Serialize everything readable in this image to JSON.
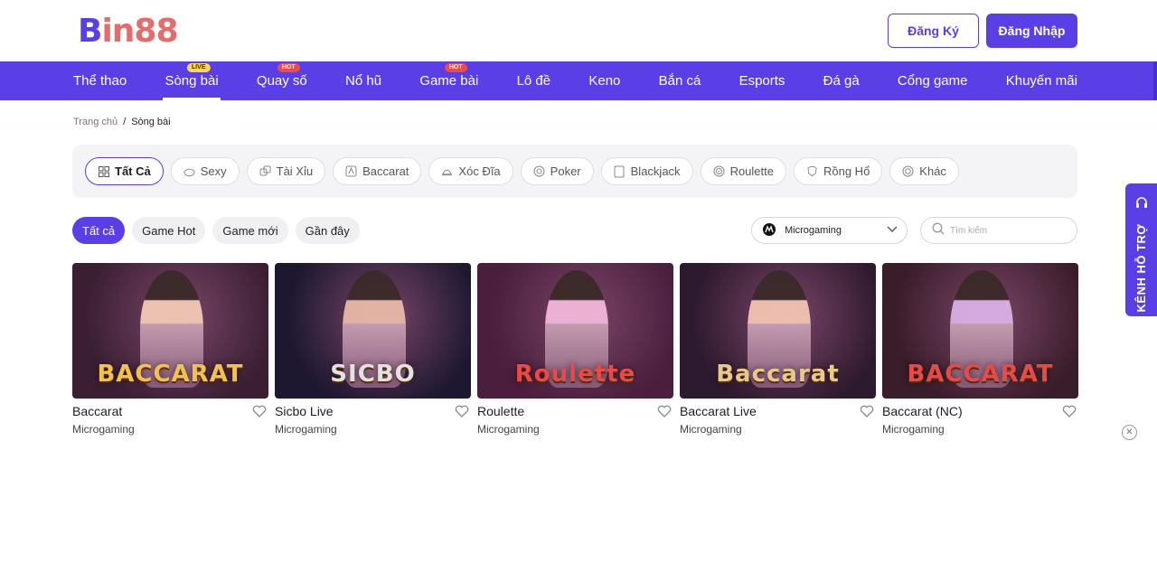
{
  "brand": {
    "logo_b": "B",
    "logo_rest": "in88"
  },
  "auth": {
    "register": "Đăng Ký",
    "login": "Đăng Nhập"
  },
  "nav": {
    "items": [
      {
        "label": "Thể thao",
        "badge": ""
      },
      {
        "label": "Sòng bài",
        "badge": "LIVE",
        "active": true
      },
      {
        "label": "Quay số",
        "badge": "HOT"
      },
      {
        "label": "Nổ hũ",
        "badge": ""
      },
      {
        "label": "Game bài",
        "badge": "HOT"
      },
      {
        "label": "Lô đề",
        "badge": ""
      },
      {
        "label": "Keno",
        "badge": ""
      },
      {
        "label": "Bắn cá",
        "badge": ""
      },
      {
        "label": "Esports",
        "badge": ""
      },
      {
        "label": "Đá gà",
        "badge": ""
      },
      {
        "label": "Cổng game",
        "badge": ""
      },
      {
        "label": "Khuyến mãi",
        "badge": ""
      }
    ]
  },
  "breadcrumb": {
    "home": "Trang chủ",
    "sep": "/",
    "current": "Sòng bài"
  },
  "categories": [
    {
      "label": "Tất Cả",
      "icon": "grid-icon",
      "active": true
    },
    {
      "label": "Sexy",
      "icon": "sexy-icon"
    },
    {
      "label": "Tài Xỉu",
      "icon": "dice-icon"
    },
    {
      "label": "Baccarat",
      "icon": "baccarat-icon"
    },
    {
      "label": "Xóc Đĩa",
      "icon": "xoc-dia-icon"
    },
    {
      "label": "Poker",
      "icon": "poker-chip-icon"
    },
    {
      "label": "Blackjack",
      "icon": "card-icon"
    },
    {
      "label": "Roulette",
      "icon": "roulette-icon"
    },
    {
      "label": "Rồng Hổ",
      "icon": "dragon-tiger-icon"
    },
    {
      "label": "Khác",
      "icon": "other-icon"
    }
  ],
  "filters": [
    {
      "label": "Tất cả",
      "active": true
    },
    {
      "label": "Game Hot"
    },
    {
      "label": "Game mới"
    },
    {
      "label": "Gần đây"
    }
  ],
  "provider_select": {
    "value": "Microgaming"
  },
  "search": {
    "placeholder": "Tìm kiếm"
  },
  "games": [
    {
      "name": "Baccarat",
      "provider": "Microgaming",
      "thumb_text": "BACCARAT",
      "bg": "#3a1f33",
      "accent": "#f2c14e"
    },
    {
      "name": "Sicbo Live",
      "provider": "Microgaming",
      "thumb_text": "SICBO",
      "bg": "#1d1830",
      "accent": "#e2e2e2"
    },
    {
      "name": "Roulette",
      "provider": "Microgaming",
      "thumb_text": "Roulette",
      "bg": "#4a1e3c",
      "accent": "#e84a4a"
    },
    {
      "name": "Baccarat Live",
      "provider": "Microgaming",
      "thumb_text": "Baccarat",
      "bg": "#2e1a2e",
      "accent": "#e9c98b"
    },
    {
      "name": "Baccarat (NC)",
      "provider": "Microgaming",
      "thumb_text": "BACCARAT",
      "bg": "#3a1d2a",
      "accent": "#e84a4a"
    }
  ],
  "support": {
    "label": "KÊNH HỖ TRỢ"
  },
  "colors": {
    "primary": "#5b3fe6",
    "logo_accent": "#e36d6d"
  }
}
